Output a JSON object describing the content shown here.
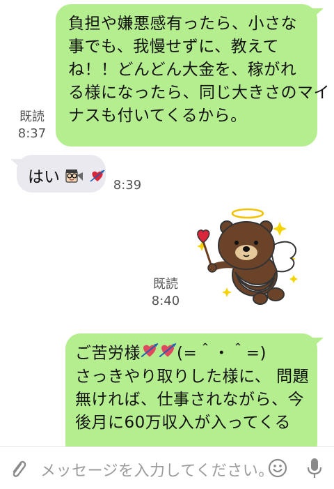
{
  "messages": [
    {
      "direction": "outgoing",
      "lines": [
        "負担や嫌悪感有ったら、小さな",
        "事でも、我慢せずに、教えて",
        "ね！！どんどん大金を、稼がれ",
        "る様になったら、同じ大きさのマイ",
        "ナスも付いてくるから。"
      ],
      "read_label": "既読",
      "time": "8:37"
    },
    {
      "direction": "incoming",
      "text": "はい",
      "emoji": [
        "man-with-glasses-icon",
        "heart-with-arrow-icon"
      ],
      "time": "8:39"
    },
    {
      "direction": "outgoing",
      "type": "sticker",
      "sticker": "brown-bear-cupid-sticker",
      "read_label": "既読",
      "time": "8:40"
    },
    {
      "direction": "outgoing",
      "lines": [
        "ご苦労様",
        "さっきやり取りした様に、 問題",
        "無ければ、仕事されながら、今",
        "後月に60万収入が入ってくる"
      ],
      "first_line_suffix": "(=＾・＾=)",
      "emoji": [
        "heart-with-arrow-icon",
        "heart-with-arrow-icon"
      ]
    }
  ],
  "input_bar": {
    "placeholder": "メッセージを入力してください。",
    "icons": [
      "paperclip-icon",
      "smiley-icon",
      "microphone-icon"
    ]
  },
  "colors": {
    "outgoing_bubble": "#b5ee8e",
    "incoming_bubble": "#e9e9ef",
    "meta_text": "#555555",
    "placeholder_text": "#9b9b9b"
  }
}
